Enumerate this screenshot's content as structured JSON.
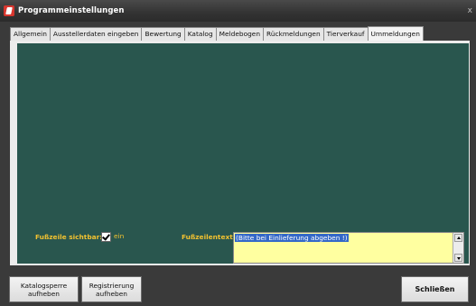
{
  "window": {
    "title": "Programmeinstellungen",
    "close_glyph": "x"
  },
  "tabs": [
    {
      "label": "Allgemein",
      "active": false
    },
    {
      "label": "Ausstellerdaten eingeben",
      "active": false
    },
    {
      "label": "Bewertung",
      "active": false
    },
    {
      "label": "Katalog",
      "active": false
    },
    {
      "label": "Meldebogen",
      "active": false
    },
    {
      "label": "Rückmeldungen",
      "active": false
    },
    {
      "label": "Tierverkauf",
      "active": false
    },
    {
      "label": "Ummeldungen",
      "active": true
    }
  ],
  "panel": {
    "footer_visible_label": "Fußzeile sichtbar:",
    "footer_visible_checked": true,
    "footer_visible_option": "ein",
    "footer_text_label": "Fußzeilentext:",
    "footer_text_value": "(Bitte bei Einlieferung abgeben !)"
  },
  "buttons": {
    "katalog_line1": "Katalogsperre",
    "katalog_line2": "aufheben",
    "reg_line1": "Registrierung",
    "reg_line2": "aufheben",
    "close": "Schließen"
  },
  "colors": {
    "panel_bg": "#29564e",
    "label_gold": "#f2c230",
    "textarea_bg": "#ffffa0",
    "selection": "#3468c8"
  }
}
